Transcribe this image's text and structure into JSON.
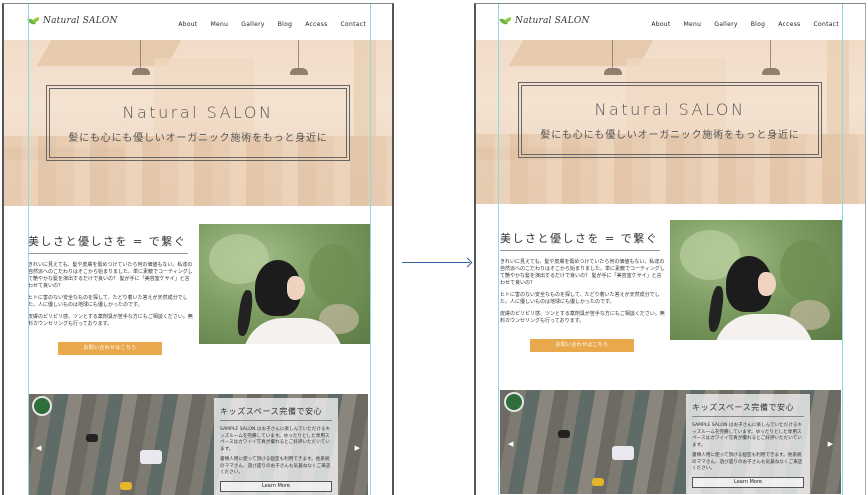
{
  "header": {
    "logo": "Natural SALON",
    "nav": [
      "About",
      "Menu",
      "Gallery",
      "Blog",
      "Access",
      "Contact"
    ]
  },
  "hero": {
    "title": "Natural SALON",
    "subtitle": "髪にも心にも優しいオーガニック施術をもっと身近に"
  },
  "section2": {
    "heading": "美しさと優しさを = で繋ぐ",
    "paragraphs": [
      "きれいに見えても、髪や皮膚を傷めつけていたら何の価値もない。私達の自然派へのこだわりはそこから始まりました。単に素敵でコーティングして艶やかな髪を演出するだけで良いの？ 髪が手に「美容室ケサイ」と言わせて良いの？",
      "ヒトに害のない安全なものを探して、たどり着いた答えが天然成分でした。人に優しいものは地球にも優しかったのです。",
      "皮膚のピリピリ感、ツンとする薬剤臭が苦手な方にもご相談ください。無料カウンセリングも行っております。"
    ],
    "button": "お問い合わせはこちら"
  },
  "section3": {
    "heading": "キッズスペース完備で安心",
    "paragraphs": [
      "SAMPLE SALON はお子さんに楽しんでいただけるキッズルームを完備しています。ゆったりとした専用スペースはカワイイ写真が撮れるとご好評いただいています。",
      "書類人用に使って頂ける個室も利用できます。他系統のママさん、遊び盛りのお子さんも気兼ねなくご来店ください。"
    ],
    "button": "Learn More"
  },
  "colors": {
    "accent": "#e9a84c",
    "guide": "#8fd9e6",
    "arrow": "#2f5f9e"
  }
}
